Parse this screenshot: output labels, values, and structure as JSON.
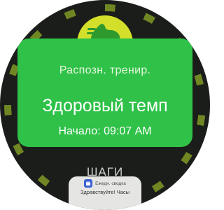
{
  "workout_toast": {
    "subtitle": "Распозн. тренир.",
    "title": "Здоровый темп",
    "start_time": "Начало: 09:07 AM",
    "color": "#2fc148"
  },
  "background": {
    "steps_label": "ШАГИ",
    "badge_icon": "running-shoe-icon",
    "accent_color": "#d3df2b"
  },
  "notification": {
    "app_icon": "calendar-icon",
    "title": "Ежедн. сводка",
    "text": "Здравствуйте! Часы"
  }
}
